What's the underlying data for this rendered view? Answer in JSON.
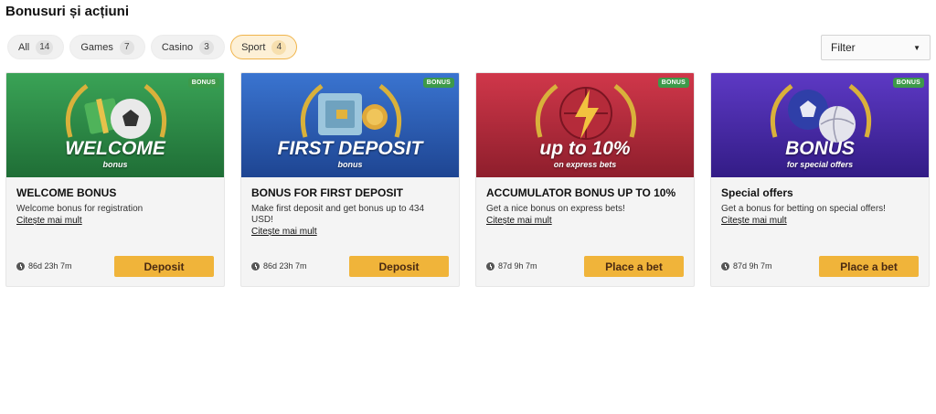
{
  "page": {
    "title": "Bonusuri și acțiuni"
  },
  "filters": [
    {
      "label": "All",
      "count": "14"
    },
    {
      "label": "Games",
      "count": "7"
    },
    {
      "label": "Casino",
      "count": "3"
    },
    {
      "label": "Sport",
      "count": "4",
      "active": true
    }
  ],
  "filter_select": {
    "value": "Filter"
  },
  "colors": {
    "accent": "#f0b43a",
    "badge": "#3d9a4a",
    "active_chip_bg": "#fdf0d6",
    "active_chip_border": "#f0b44b"
  },
  "cards": [
    {
      "badge": "BONUS",
      "banner_title": "WELCOME",
      "banner_sub": "bonus",
      "banner_color": "#2e8a45",
      "banner_icon": "gift-and-football-icon",
      "title": "WELCOME BONUS",
      "desc": "Welcome bonus for registration",
      "read_more": "Citește mai mult",
      "time": "86d 23h 7m",
      "button": "Deposit"
    },
    {
      "badge": "BONUS",
      "banner_title": "FIRST DEPOSIT",
      "banner_sub": "bonus",
      "banner_color": "#2f5fb8",
      "banner_icon": "safe-and-coin-icon",
      "title": "BONUS FOR FIRST DEPOSIT",
      "desc": "Make first deposit and get bonus up to 434 USD!",
      "read_more": "Citește mai mult",
      "time": "86d 23h 7m",
      "button": "Deposit"
    },
    {
      "badge": "BONUS",
      "banner_title": "up to 10%",
      "banner_sub": "on express bets",
      "banner_color": "#b8283a",
      "banner_icon": "basketball-lightning-icon",
      "title": "ACCUMULATOR BONUS UP TO 10%",
      "desc": "Get a nice bonus on express bets!",
      "read_more": "Citește mai mult",
      "time": "87d 9h 7m",
      "button": "Place a bet"
    },
    {
      "badge": "BONUS",
      "banner_title": "BONUS",
      "banner_sub": "for special offers",
      "banner_color": "#4a2aa8",
      "banner_icon": "balls-icon",
      "title": "Special offers",
      "desc": "Get a bonus for betting on special offers!",
      "read_more": "Citește mai mult",
      "time": "87d 9h 7m",
      "button": "Place a bet"
    }
  ]
}
